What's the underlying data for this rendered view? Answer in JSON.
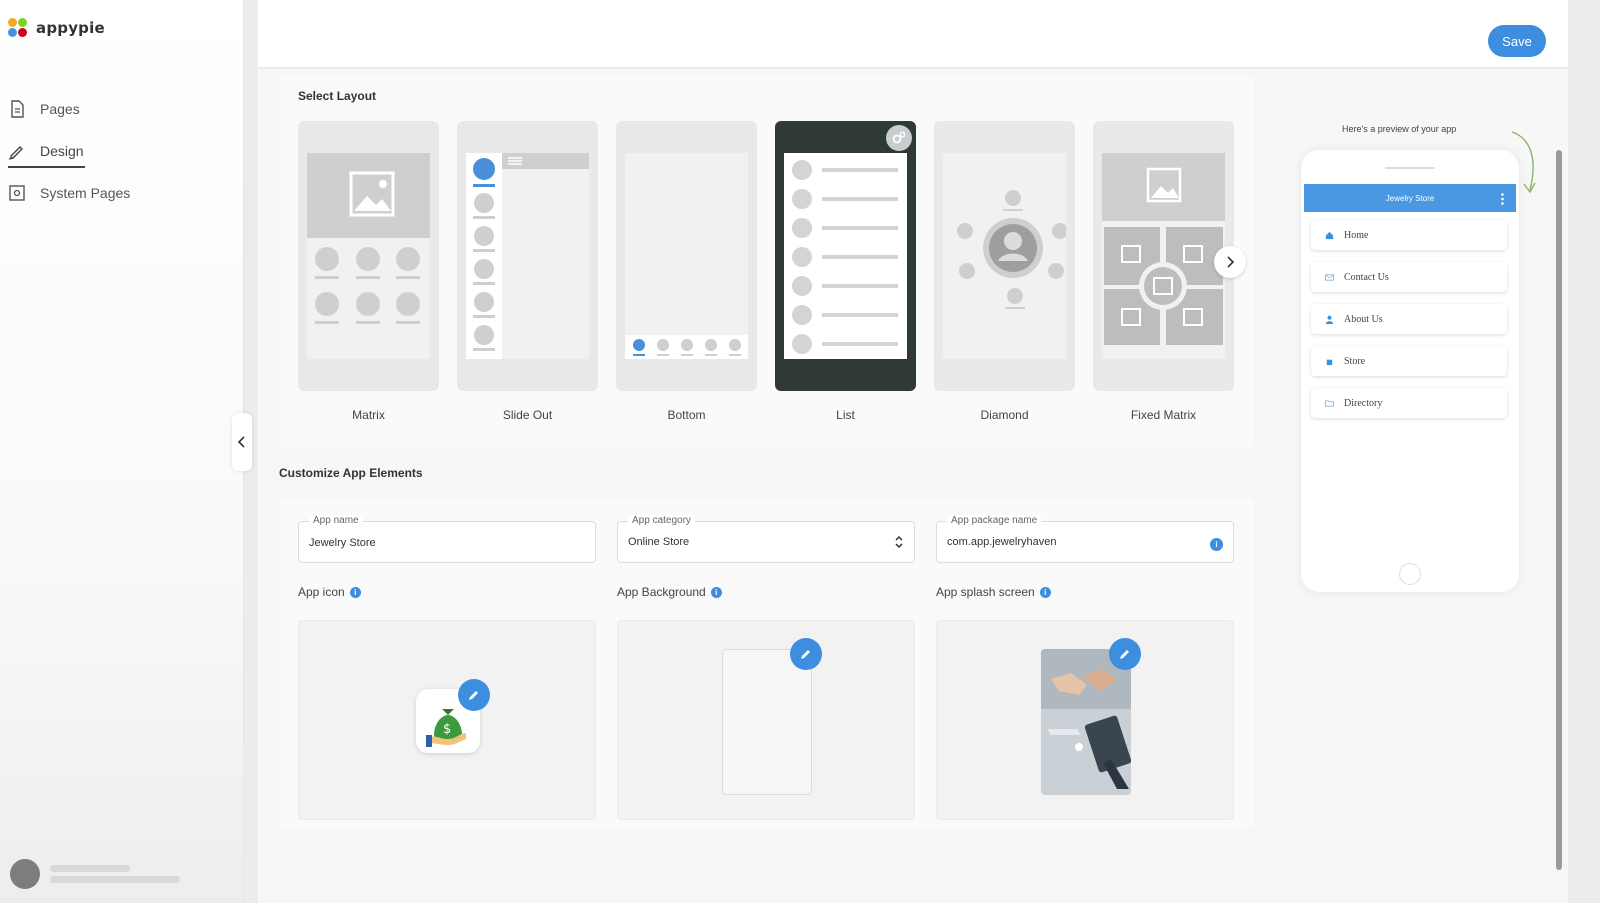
{
  "app": {
    "logo_text": "appypie"
  },
  "sidebar": {
    "items": [
      {
        "label": "Pages",
        "icon": "page-icon"
      },
      {
        "label": "Design",
        "icon": "pencil-icon"
      },
      {
        "label": "System Pages",
        "icon": "system-pages-icon"
      }
    ],
    "active": "Design"
  },
  "header": {
    "save_label": "Save"
  },
  "layout": {
    "title": "Select Layout",
    "options": [
      "Matrix",
      "Slide Out",
      "Bottom",
      "List",
      "Diamond",
      "Fixed Matrix"
    ],
    "selected": "List"
  },
  "customize": {
    "title": "Customize App Elements",
    "app_name": {
      "label": "App name",
      "value": "Jewelry Store"
    },
    "app_category": {
      "label": "App category",
      "value": "Online Store"
    },
    "app_package": {
      "label": "App package name",
      "value": "com.app.jewelryhaven"
    },
    "app_icon_label": "App icon",
    "app_background_label": "App Background",
    "app_splash_label": "App splash screen"
  },
  "preview": {
    "caption": "Here's a preview of your app",
    "app_title": "Jewelry Store",
    "menu": [
      {
        "label": "Home",
        "icon": "home-icon"
      },
      {
        "label": "Contact Us",
        "icon": "mail-icon"
      },
      {
        "label": "About Us",
        "icon": "person-icon"
      },
      {
        "label": "Store",
        "icon": "store-icon"
      },
      {
        "label": "Directory",
        "icon": "folder-icon"
      }
    ]
  },
  "colors": {
    "accent": "#3e8ee0",
    "phone_bar": "#4a97e2",
    "selected_layout": "#2f3a36"
  }
}
